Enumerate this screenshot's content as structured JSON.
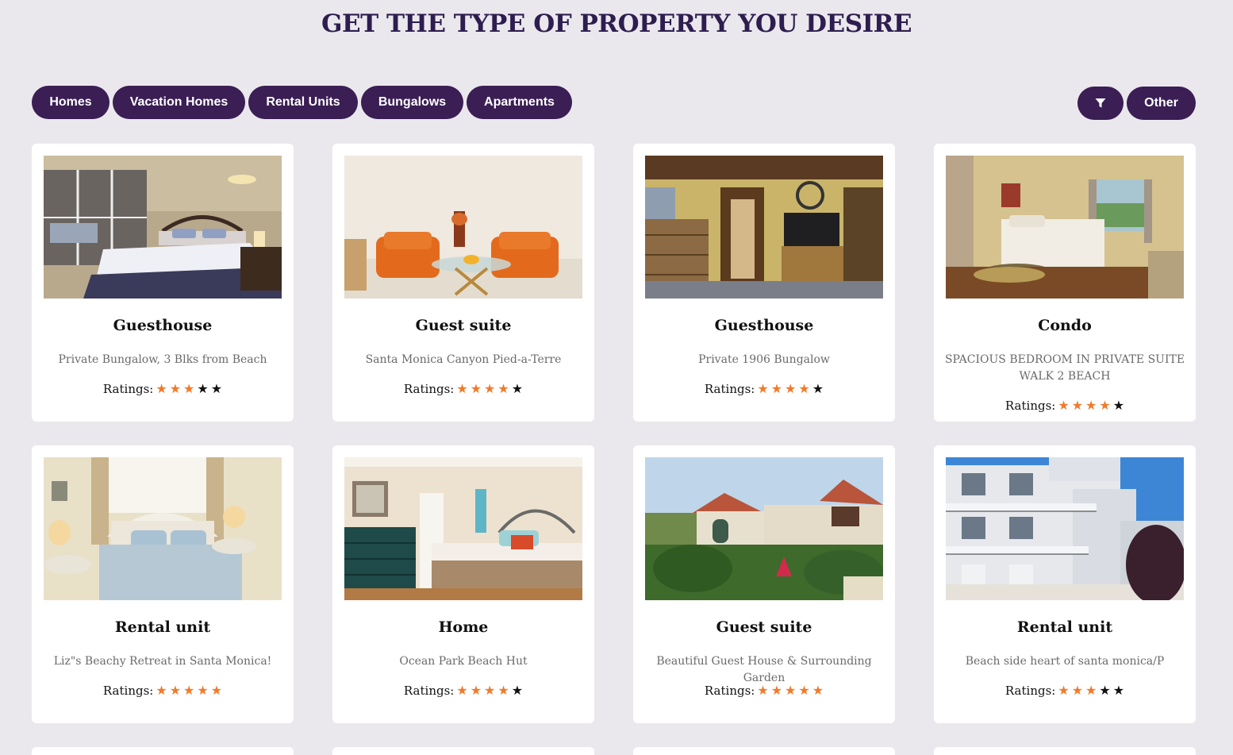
{
  "page_title": "GET THE TYPE OF PROPERTY YOU DESIRE",
  "filters": [
    "Homes",
    "Vacation Homes",
    "Rental Units",
    "Bungalows",
    "Apartments"
  ],
  "filter_button_icon": "filter-icon",
  "other_label": "Other",
  "ratings_label": "Ratings:",
  "colors": {
    "accent": "#3a1e54",
    "star_on": "#f27a2a",
    "star_off": "#111111",
    "background": "#eae8ed"
  },
  "cards": [
    {
      "type": "Guesthouse",
      "title": "Private Bungalow, 3 Blks from Beach",
      "rating": 3,
      "image": "bedroom-mirror-closet"
    },
    {
      "type": "Guest suite",
      "title": "Santa Monica Canyon Pied-a-Terre",
      "rating": 4,
      "image": "living-room-orange-sofa"
    },
    {
      "type": "Guesthouse",
      "title": "Private 1906 Bungalow",
      "rating": 4,
      "image": "bedroom-tv-dresser"
    },
    {
      "type": "Condo",
      "title": "SPACIOUS BEDROOM IN PRIVATE SUITE WALK 2 BEACH",
      "rating": 4,
      "image": "bedroom-window-view"
    },
    {
      "type": "Rental unit",
      "title": "Liz\"s Beachy Retreat in Santa Monica!",
      "rating": 5,
      "image": "bedroom-white-headboard"
    },
    {
      "type": "Home",
      "title": "Ocean Park Beach Hut",
      "rating": 4,
      "image": "bedroom-teal-dresser"
    },
    {
      "type": "Guest suite",
      "title": "Beautiful Guest House & Surrounding Garden",
      "rating": 5,
      "image": "house-exterior-garden"
    },
    {
      "type": "Rental unit",
      "title": "Beach side heart of santa monica/P",
      "rating": 3,
      "image": "apartment-building-balconies"
    }
  ]
}
